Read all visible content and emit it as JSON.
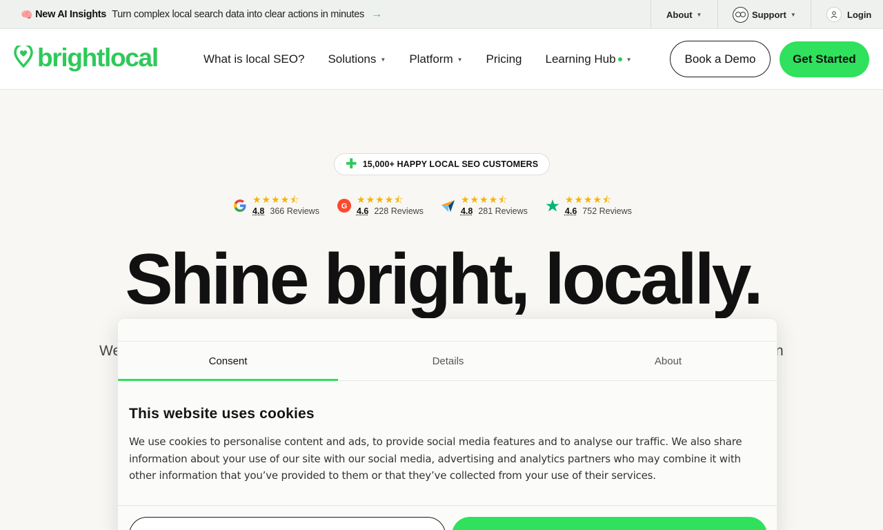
{
  "topbar": {
    "brain_emoji": "🧠",
    "new_label": "New AI Insights",
    "message": "Turn complex local search data into clear actions in minutes",
    "arrow": "→",
    "about": "About",
    "support": "Support",
    "login": "Login"
  },
  "header": {
    "logo_text": "brightlocal",
    "nav": {
      "local_seo": "What is local SEO?",
      "solutions": "Solutions",
      "platform": "Platform",
      "pricing": "Pricing",
      "learning_hub": "Learning Hub"
    },
    "book_demo": "Book a Demo",
    "get_started": "Get Started"
  },
  "hero": {
    "badge": "15,000+ HAPPY LOCAL SEO CUSTOMERS",
    "ratings": [
      {
        "source_icon": "google-icon",
        "score": "4.8",
        "reviews": "366 Reviews"
      },
      {
        "source_icon": "g2-icon",
        "score": "4.6",
        "reviews": "228 Reviews"
      },
      {
        "source_icon": "capterra-icon",
        "score": "4.8",
        "reviews": "281 Reviews"
      },
      {
        "source_icon": "trustpilot-icon",
        "score": "4.6",
        "reviews": "752 Reviews"
      }
    ],
    "stars": "★★★★⯪",
    "headline": "Shine bright, locally.",
    "sub_left_fragment": "We",
    "sub_right_fragment": "n"
  },
  "cookie": {
    "tabs": [
      "Consent",
      "Details",
      "About"
    ],
    "active_tab": "Consent",
    "title": "This website uses cookies",
    "body": "We use cookies to personalise content and ads, to provide social media features and to analyse our traffic. We also share information about your use of our site with our social media, advertising and analytics partners who may combine it with other information that you’ve provided to them or that they’ve collected from your use of their services."
  },
  "colors": {
    "brand_green": "#2ec95a",
    "button_green": "#2fe15c",
    "star_yellow": "#f4b400",
    "text_dark": "#111111"
  }
}
